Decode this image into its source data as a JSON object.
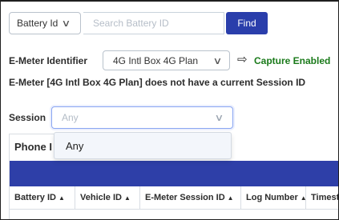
{
  "search": {
    "type_select": "Battery Id",
    "placeholder": "Search Battery ID",
    "find_label": "Find"
  },
  "emeter": {
    "label": "E-Meter Identifier",
    "selected": "4G Intl Box 4G Plan",
    "capture_label": "Capture Enabled",
    "message": "E-Meter [4G Intl Box 4G Plan] does not have a current Session ID"
  },
  "session": {
    "label": "Session",
    "placeholder": "Any",
    "options": [
      "Any"
    ]
  },
  "tabs": {
    "phone_label": "Phone I"
  },
  "table": {
    "columns": [
      "Battery ID",
      "Vehicle ID",
      "E-Meter Session ID",
      "Log Number",
      "Timest"
    ]
  },
  "colors": {
    "primary": "#2e3fa8",
    "success": "#1a7a1a",
    "focus": "#8aa6f2"
  },
  "icons": {
    "chevron": "chevron-down-icon",
    "capture": "arrow-right-outline-icon",
    "sort": "sort-up-icon"
  }
}
